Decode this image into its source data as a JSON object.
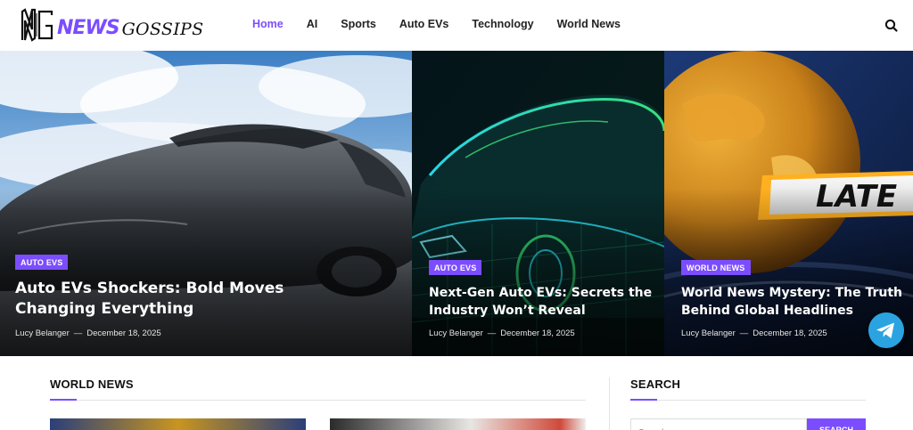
{
  "brand": {
    "logo_news": "NEWS",
    "logo_gossips": "GOSSIPS",
    "accent_color": "#7b4dff"
  },
  "nav": {
    "items": [
      {
        "label": "Home",
        "active": true
      },
      {
        "label": "AI"
      },
      {
        "label": "Sports"
      },
      {
        "label": "Auto EVs"
      },
      {
        "label": "Technology"
      },
      {
        "label": "World News"
      }
    ],
    "search_icon": "search-icon"
  },
  "hero": [
    {
      "category": "AUTO EVS",
      "title": "Auto EVs Shockers: Bold Moves Changing Everything",
      "author": "Lucy Belanger",
      "separator": "—",
      "date": "December 18, 2025"
    },
    {
      "category": "AUTO EVS",
      "title": "Next-Gen Auto EVs: Secrets the Industry Won’t Reveal",
      "author": "Lucy Belanger",
      "separator": "—",
      "date": "December 18, 2025"
    },
    {
      "category": "WORLD NEWS",
      "title": "World News Mystery: The Truth Behind Global Headlines",
      "author": "Lucy Belanger",
      "separator": "—",
      "date": "December 18, 2025"
    }
  ],
  "hero_image_text": "LATE",
  "sections": {
    "world_news": "WORLD NEWS",
    "search": "SEARCH"
  },
  "search_widget": {
    "placeholder": "Search",
    "button_label": "SEARCH"
  },
  "telegram_icon": "telegram-icon"
}
